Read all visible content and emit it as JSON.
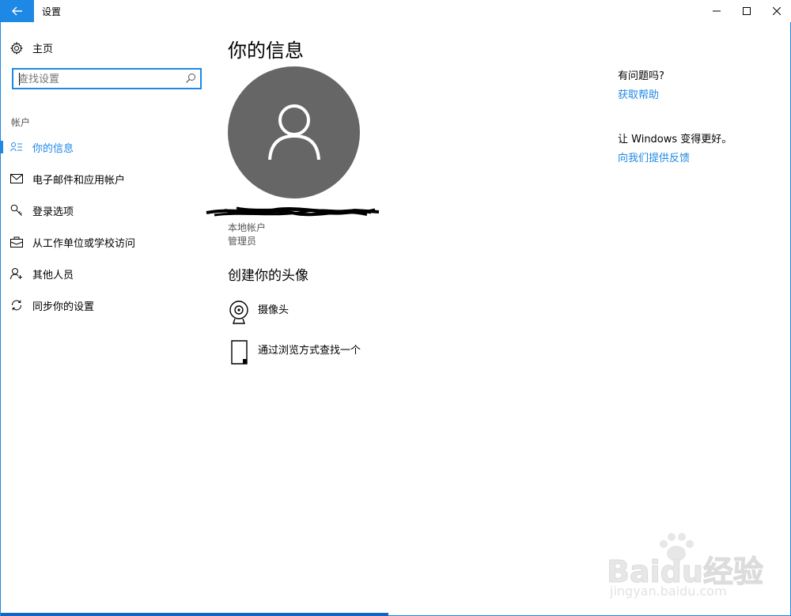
{
  "window": {
    "title": "设置"
  },
  "nav": {
    "home_label": "主页",
    "search_placeholder": "查找设置",
    "section_label": "帐户",
    "items": [
      {
        "label": "你的信息",
        "icon": "person-list-icon",
        "active": true
      },
      {
        "label": "电子邮件和应用帐户",
        "icon": "mail-icon",
        "active": false
      },
      {
        "label": "登录选项",
        "icon": "key-icon",
        "active": false
      },
      {
        "label": "从工作单位或学校访问",
        "icon": "briefcase-icon",
        "active": false
      },
      {
        "label": "其他人员",
        "icon": "person-add-icon",
        "active": false
      },
      {
        "label": "同步你的设置",
        "icon": "sync-icon",
        "active": false
      }
    ]
  },
  "main": {
    "title": "你的信息",
    "account_type": "本地帐户",
    "account_role": "管理员",
    "create_avatar_title": "创建你的头像",
    "options": [
      {
        "label": "摄像头",
        "icon": "webcam-icon"
      },
      {
        "label": "通过浏览方式查找一个",
        "icon": "document-icon"
      }
    ]
  },
  "side": {
    "help_question": "有问题吗?",
    "help_link": "获取帮助",
    "better_question": "让 Windows 变得更好。",
    "feedback_link": "向我们提供反馈"
  },
  "watermark": {
    "brand": "Baidu经验",
    "url": "jingyan.baidu.com"
  },
  "colors": {
    "accent": "#1e88e5",
    "avatar_bg": "#666666"
  }
}
